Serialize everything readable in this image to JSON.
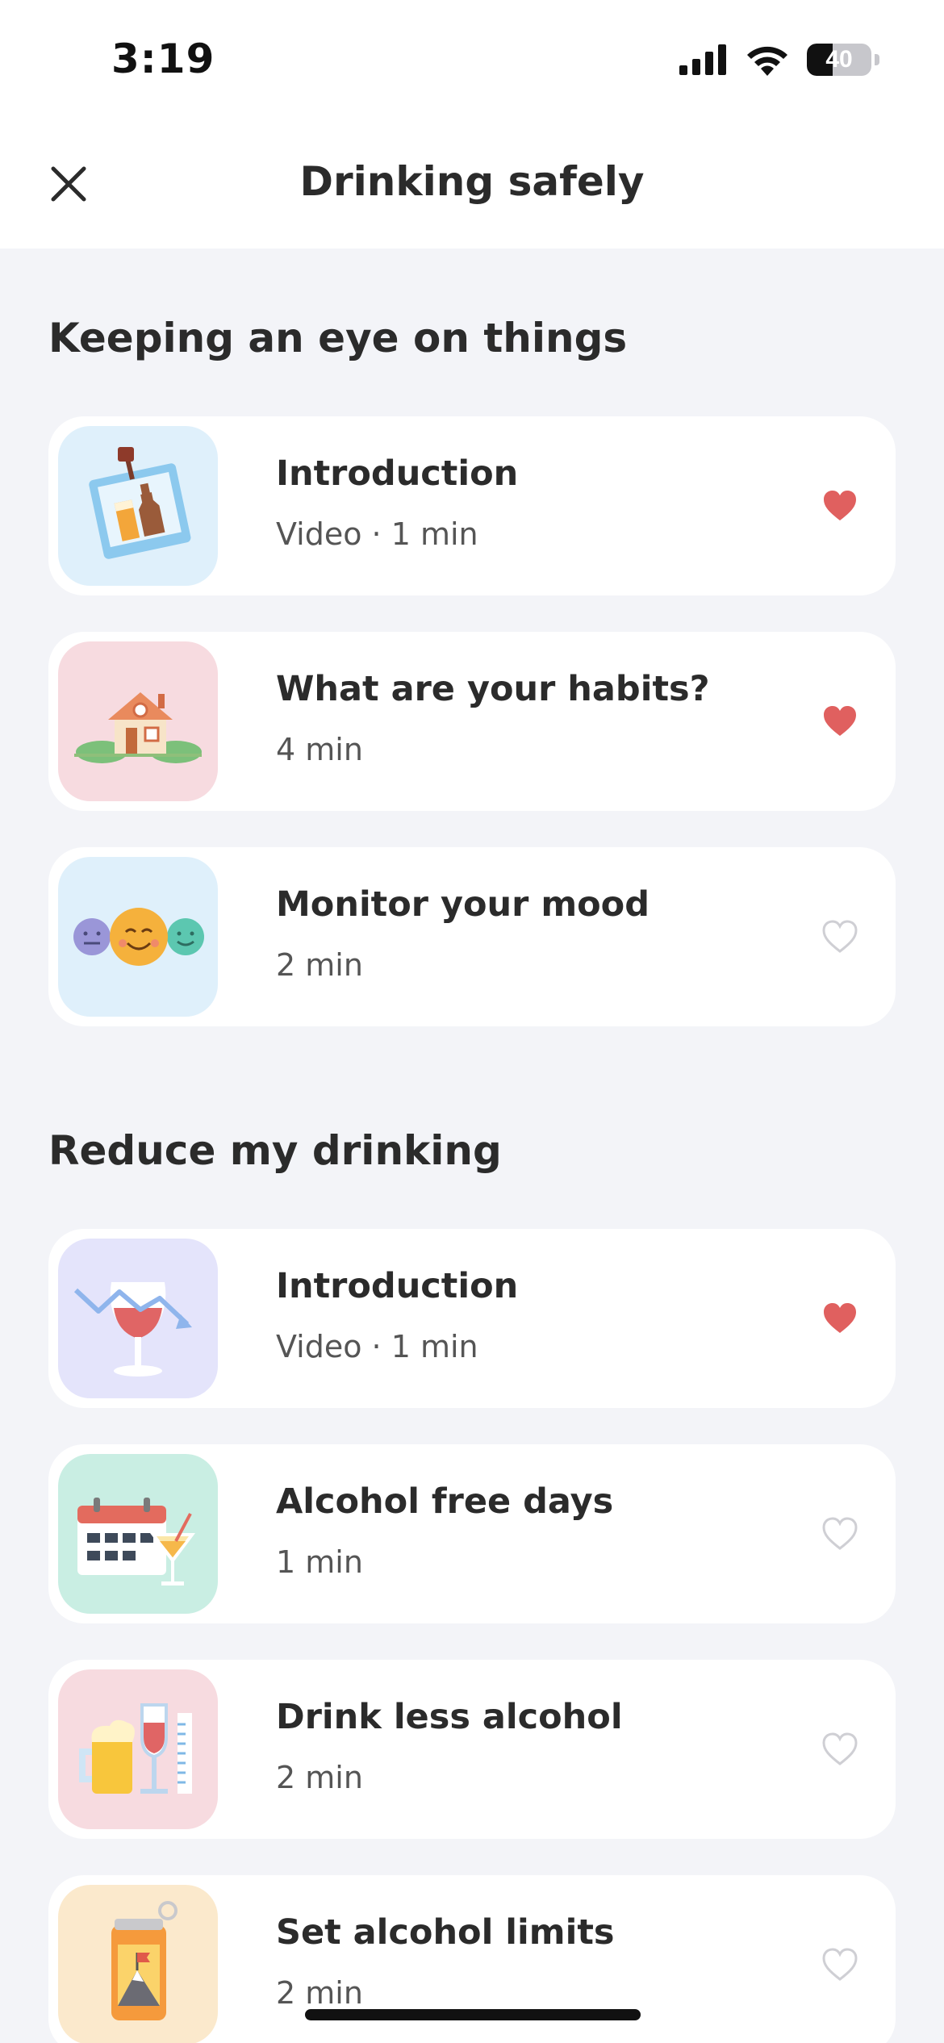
{
  "status_bar": {
    "time": "3:19",
    "battery_percent": "40",
    "battery_level": 0.4
  },
  "nav": {
    "title": "Drinking safely",
    "close_icon": "close-icon"
  },
  "sections": [
    {
      "title": "Keeping an eye on things",
      "items": [
        {
          "title": "Introduction",
          "meta": "Video · 1 min",
          "favorited": true,
          "thumb_bg": "#dff0fb",
          "icon": "photo-drinks-icon"
        },
        {
          "title": "What are your habits?",
          "meta": "4 min",
          "favorited": true,
          "thumb_bg": "#f7dbe0",
          "icon": "house-icon"
        },
        {
          "title": "Monitor your mood",
          "meta": "2 min",
          "favorited": false,
          "thumb_bg": "#dff0fb",
          "icon": "mood-faces-icon"
        }
      ]
    },
    {
      "title": "Reduce my drinking",
      "items": [
        {
          "title": "Introduction",
          "meta": "Video · 1 min",
          "favorited": true,
          "thumb_bg": "#e4e4fb",
          "icon": "wine-glass-trend-icon"
        },
        {
          "title": "Alcohol free days",
          "meta": "1 min",
          "favorited": false,
          "thumb_bg": "#c9eee3",
          "icon": "calendar-cocktail-icon"
        },
        {
          "title": "Drink less alcohol",
          "meta": "2 min",
          "favorited": false,
          "thumb_bg": "#f7dbe0",
          "icon": "beer-wine-measure-icon"
        },
        {
          "title": "Set alcohol limits",
          "meta": "2 min",
          "favorited": false,
          "thumb_bg": "#fbe9cc",
          "icon": "can-mountain-icon"
        }
      ]
    }
  ],
  "colors": {
    "heart_filled": "#e0605f",
    "heart_outline": "#cfcfd4",
    "page_bg": "#f3f4f8"
  }
}
